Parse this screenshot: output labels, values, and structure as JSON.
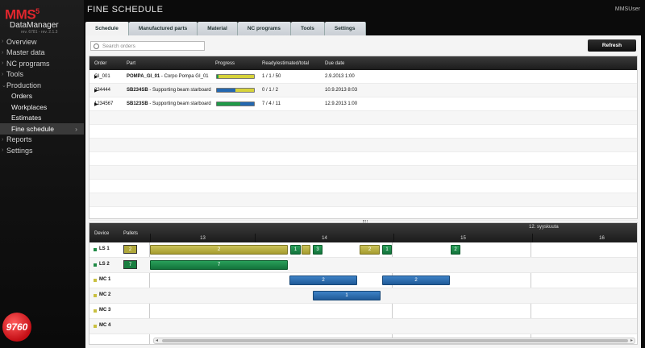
{
  "app": {
    "logo_main": "MMS",
    "logo_sup": "5",
    "logo_sub": "DataManager",
    "logo_version": "rev. 6781 - rev. 2.1.3",
    "page_title": "FINE SCHEDULE",
    "user": "MMSUser",
    "badge": "9760"
  },
  "sidebar": {
    "items": [
      {
        "label": "Overview"
      },
      {
        "label": "Master data"
      },
      {
        "label": "NC programs"
      },
      {
        "label": "Tools"
      },
      {
        "label": "Production"
      },
      {
        "label": "Orders"
      },
      {
        "label": "Workplaces"
      },
      {
        "label": "Estimates"
      },
      {
        "label": "Fine schedule"
      },
      {
        "label": "Reports"
      },
      {
        "label": "Settings"
      }
    ]
  },
  "tabs": [
    "Schedule",
    "Manufactured parts",
    "Material",
    "NC programs",
    "Tools",
    "Settings"
  ],
  "search": {
    "placeholder": "Search orders"
  },
  "toolbar": {
    "refresh_label": "Refresh"
  },
  "orders_table": {
    "headers": {
      "order": "Order",
      "part": "Part",
      "progress": "Progress",
      "ready": "Ready/estimated/total",
      "due": "Due date"
    },
    "rows": [
      {
        "order": "GI_001",
        "part_code": "POMPA_GI_01",
        "part_desc": "- Corpo Pompa GI_01",
        "ready": "1 / 1 / 50",
        "due": "2.9.2013 1:00",
        "progress": {
          "green": 0.04,
          "blue": 0,
          "yellow": 0.96
        }
      },
      {
        "order": "234444",
        "part_code": "SB234SB",
        "part_desc": "- Supporting beam starboard",
        "ready": "0 / 1 / 2",
        "due": "10.9.2013 8:03",
        "progress": {
          "green": 0,
          "blue": 0.5,
          "yellow": 0.5
        }
      },
      {
        "order": "1234567",
        "part_code": "SB123SB",
        "part_desc": "- Supporting beam starboard",
        "ready": "7 / 4 / 11",
        "due": "12.9.2013 1:00",
        "progress": {
          "green": 0.64,
          "blue": 0.36,
          "yellow": 0
        }
      }
    ]
  },
  "gantt": {
    "headers": {
      "device": "Device",
      "pallets": "Pallets"
    },
    "week_label": "12. syyskuuta",
    "days": [
      "13",
      "14",
      "15",
      "16"
    ],
    "devices": [
      {
        "name": "LS 1",
        "color": "#1f8a45",
        "pallet": "2",
        "pallet_color": "#b0a83b"
      },
      {
        "name": "LS 2",
        "color": "#1f8a45",
        "pallet": "7",
        "pallet_color": "#1a7e40"
      },
      {
        "name": "MC 1",
        "color": "#c9c040",
        "pallet": "",
        "pallet_color": ""
      },
      {
        "name": "MC 2",
        "color": "#c9c040",
        "pallet": "",
        "pallet_color": ""
      },
      {
        "name": "MC 3",
        "color": "#c9c040",
        "pallet": "",
        "pallet_color": ""
      },
      {
        "name": "MC 4",
        "color": "#c9c040",
        "pallet": "",
        "pallet_color": ""
      }
    ],
    "bars": [
      {
        "row": 0,
        "label": "2",
        "color": "yellow"
      },
      {
        "row": 0,
        "label": "1",
        "color": "green"
      },
      {
        "row": 0,
        "label": "",
        "color": "yellow"
      },
      {
        "row": 0,
        "label": "3",
        "color": "green"
      },
      {
        "row": 0,
        "label": "2",
        "color": "yellow"
      },
      {
        "row": 0,
        "label": "1",
        "color": "green"
      },
      {
        "row": 0,
        "label": "2",
        "color": "green"
      },
      {
        "row": 1,
        "label": "7",
        "color": "green"
      },
      {
        "row": 2,
        "label": "2",
        "color": "blue"
      },
      {
        "row": 2,
        "label": "2",
        "color": "blue"
      },
      {
        "row": 3,
        "label": "1",
        "color": "blue"
      }
    ]
  }
}
